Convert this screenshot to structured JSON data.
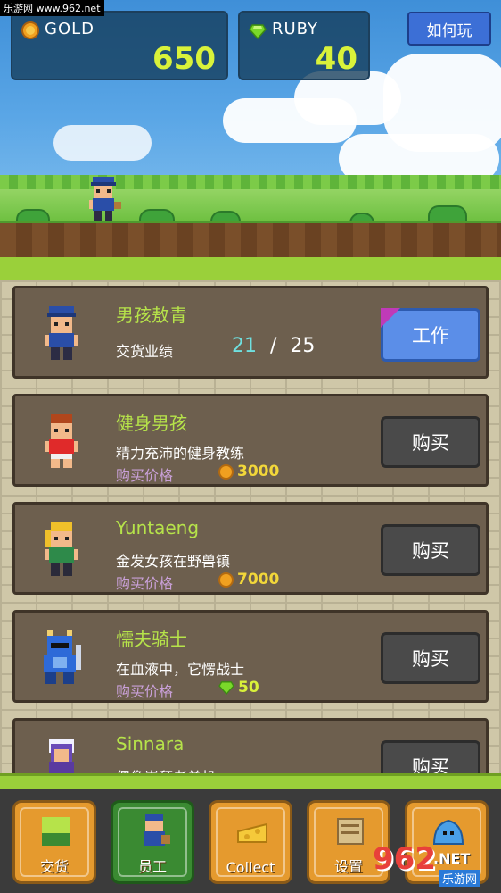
{
  "watermark": "乐游网 www.962.net",
  "hud": {
    "gold": {
      "label": "GOLD",
      "value": "650"
    },
    "ruby": {
      "label": "RUBY",
      "value": "40"
    },
    "help_label": "如何玩"
  },
  "cards": [
    {
      "title": "男孩敖青",
      "sub": "交货业绩",
      "progress": "21",
      "slash": "/",
      "target": "25",
      "action": "工作"
    },
    {
      "title": "健身男孩",
      "sub": "精力充沛的健身教练",
      "price_label": "购买价格",
      "price": "3000",
      "currency": "gold",
      "action": "购买"
    },
    {
      "title": "Yuntaeng",
      "sub": "金发女孩在野兽镇",
      "price_label": "购买价格",
      "price": "7000",
      "currency": "gold",
      "action": "购买"
    },
    {
      "title": "懦夫骑士",
      "sub": "在血液中，它愣战士",
      "price_label": "购买价格",
      "price": "50",
      "currency": "ruby",
      "action": "购买"
    },
    {
      "title": "Sinnara",
      "sub": "偶像崇拜者单机",
      "action": "购买"
    }
  ],
  "nav": [
    {
      "label": "交货",
      "icon": "cube-icon"
    },
    {
      "label": "员工",
      "icon": "worker-icon"
    },
    {
      "label": "Collect",
      "icon": "cheese-icon"
    },
    {
      "label": "设置",
      "icon": "scroll-icon"
    },
    {
      "label": "",
      "icon": "slime-icon"
    }
  ],
  "logo": {
    "text": "962",
    "suffix": ".NET",
    "sub": "乐游网"
  },
  "colors": {
    "title": "#b6e34a",
    "progress": "#6fe0e0",
    "gold": "#f2d73a",
    "ruby": "#d9f23a",
    "work": "#5b8ee8"
  }
}
